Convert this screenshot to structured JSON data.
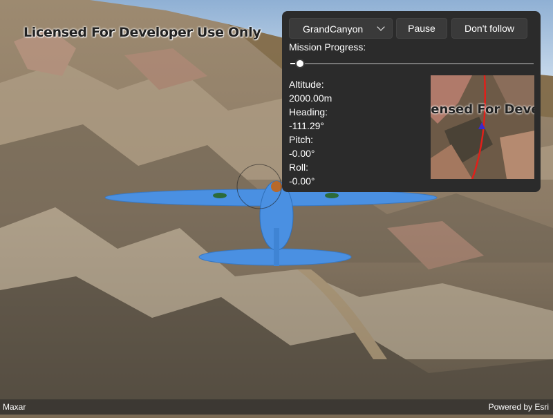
{
  "scene": {
    "watermark": "Licensed For Developer Use Only",
    "attribution_left": "Maxar",
    "attribution_right": "Powered by Esri"
  },
  "panel": {
    "mission_select": {
      "selected": "GrandCanyon"
    },
    "pause_label": "Pause",
    "follow_label": "Don't follow",
    "mission_progress_label": "Mission Progress:",
    "mission_progress": 0.03,
    "altitude_label": "Altitude:",
    "altitude_value": "2000.00m",
    "heading_label": "Heading:",
    "heading_value": "-111.29°",
    "pitch_label": "Pitch:",
    "pitch_value": "-0.00°",
    "roll_label": "Roll:",
    "roll_value": "-0.00°",
    "minimap": {
      "watermark": "Licensed For Developer Use Only",
      "route_color": "#e0201a",
      "marker_color": "#3a2bd0"
    }
  },
  "colors": {
    "plane": "#4a90e2",
    "sky": "#a8c4e0",
    "panel_bg": "#2b2b2b"
  }
}
